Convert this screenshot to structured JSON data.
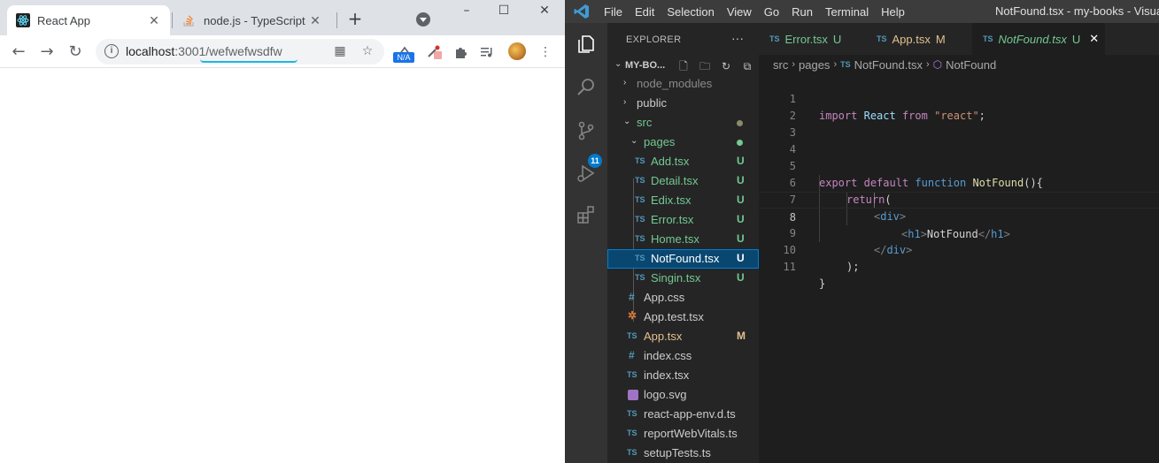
{
  "browser": {
    "tabs": [
      {
        "title": "React App",
        "icon": "react-icon"
      },
      {
        "title": "node.js - TypeScript S",
        "icon": "stackoverflow-icon"
      }
    ],
    "address": {
      "host": "localhost",
      "port_path": ":3001/wefwefwsdfw"
    },
    "ext_badge": "N/A"
  },
  "vscode": {
    "menu": [
      "File",
      "Edit",
      "Selection",
      "View",
      "Go",
      "Run",
      "Terminal",
      "Help"
    ],
    "window_title": "NotFound.tsx - my-books - Visual S",
    "activity_badge": "11",
    "explorer": {
      "header": "EXPLORER",
      "root": "MY-BO...",
      "items": [
        {
          "name": "node_modules",
          "type": "folder",
          "collapsed": true
        },
        {
          "name": "public",
          "type": "folder",
          "collapsed": true
        },
        {
          "name": "src",
          "type": "folder",
          "collapsed": false
        },
        {
          "name": "pages",
          "type": "folder",
          "collapsed": false
        },
        {
          "name": "Add.tsx",
          "type": "ts",
          "status": "U"
        },
        {
          "name": "Detail.tsx",
          "type": "ts",
          "status": "U"
        },
        {
          "name": "Edix.tsx",
          "type": "ts",
          "status": "U"
        },
        {
          "name": "Error.tsx",
          "type": "ts",
          "status": "U"
        },
        {
          "name": "Home.tsx",
          "type": "ts",
          "status": "U"
        },
        {
          "name": "NotFound.tsx",
          "type": "ts",
          "status": "U",
          "selected": true
        },
        {
          "name": "Singin.tsx",
          "type": "ts",
          "status": "U"
        },
        {
          "name": "App.css",
          "type": "css"
        },
        {
          "name": "App.test.tsx",
          "type": "test"
        },
        {
          "name": "App.tsx",
          "type": "ts",
          "status": "M"
        },
        {
          "name": "index.css",
          "type": "css"
        },
        {
          "name": "index.tsx",
          "type": "ts"
        },
        {
          "name": "logo.svg",
          "type": "svg"
        },
        {
          "name": "react-app-env.d.ts",
          "type": "ts"
        },
        {
          "name": "reportWebVitals.ts",
          "type": "ts"
        },
        {
          "name": "setupTests.ts",
          "type": "ts"
        }
      ]
    },
    "editor_tabs": [
      {
        "name": "Error.tsx",
        "status": "U"
      },
      {
        "name": "App.tsx",
        "status": "M"
      },
      {
        "name": "NotFound.tsx",
        "status": "U",
        "active": true
      }
    ],
    "breadcrumb": {
      "folder1": "src",
      "folder2": "pages",
      "file": "NotFound.tsx",
      "symbol": "NotFound"
    },
    "ts_label": "TS",
    "code_lines": [
      "1",
      "2",
      "3",
      "4",
      "5",
      "6",
      "7",
      "8",
      "9",
      "10",
      "11"
    ],
    "code": {
      "l1_kw": "import",
      "l1_name": "React",
      "l1_from": "from",
      "l1_str": "\"react\"",
      "l1_end": ";",
      "l5_export": "export",
      "l5_default": "default",
      "l5_function": "function",
      "l5_name": "NotFound",
      "l5_end": "(){",
      "l6_return": "return",
      "l6_paren": "(",
      "l7_tag": "div",
      "l8_tag": "h1",
      "l8_text": "NotFound",
      "l9_tag": "div",
      "l10_end": ");",
      "l11_end": "}"
    },
    "colors": {
      "accent": "#007acc",
      "untracked": "#73c991",
      "modified": "#e2c08d",
      "ts_icon": "#519aba"
    }
  }
}
